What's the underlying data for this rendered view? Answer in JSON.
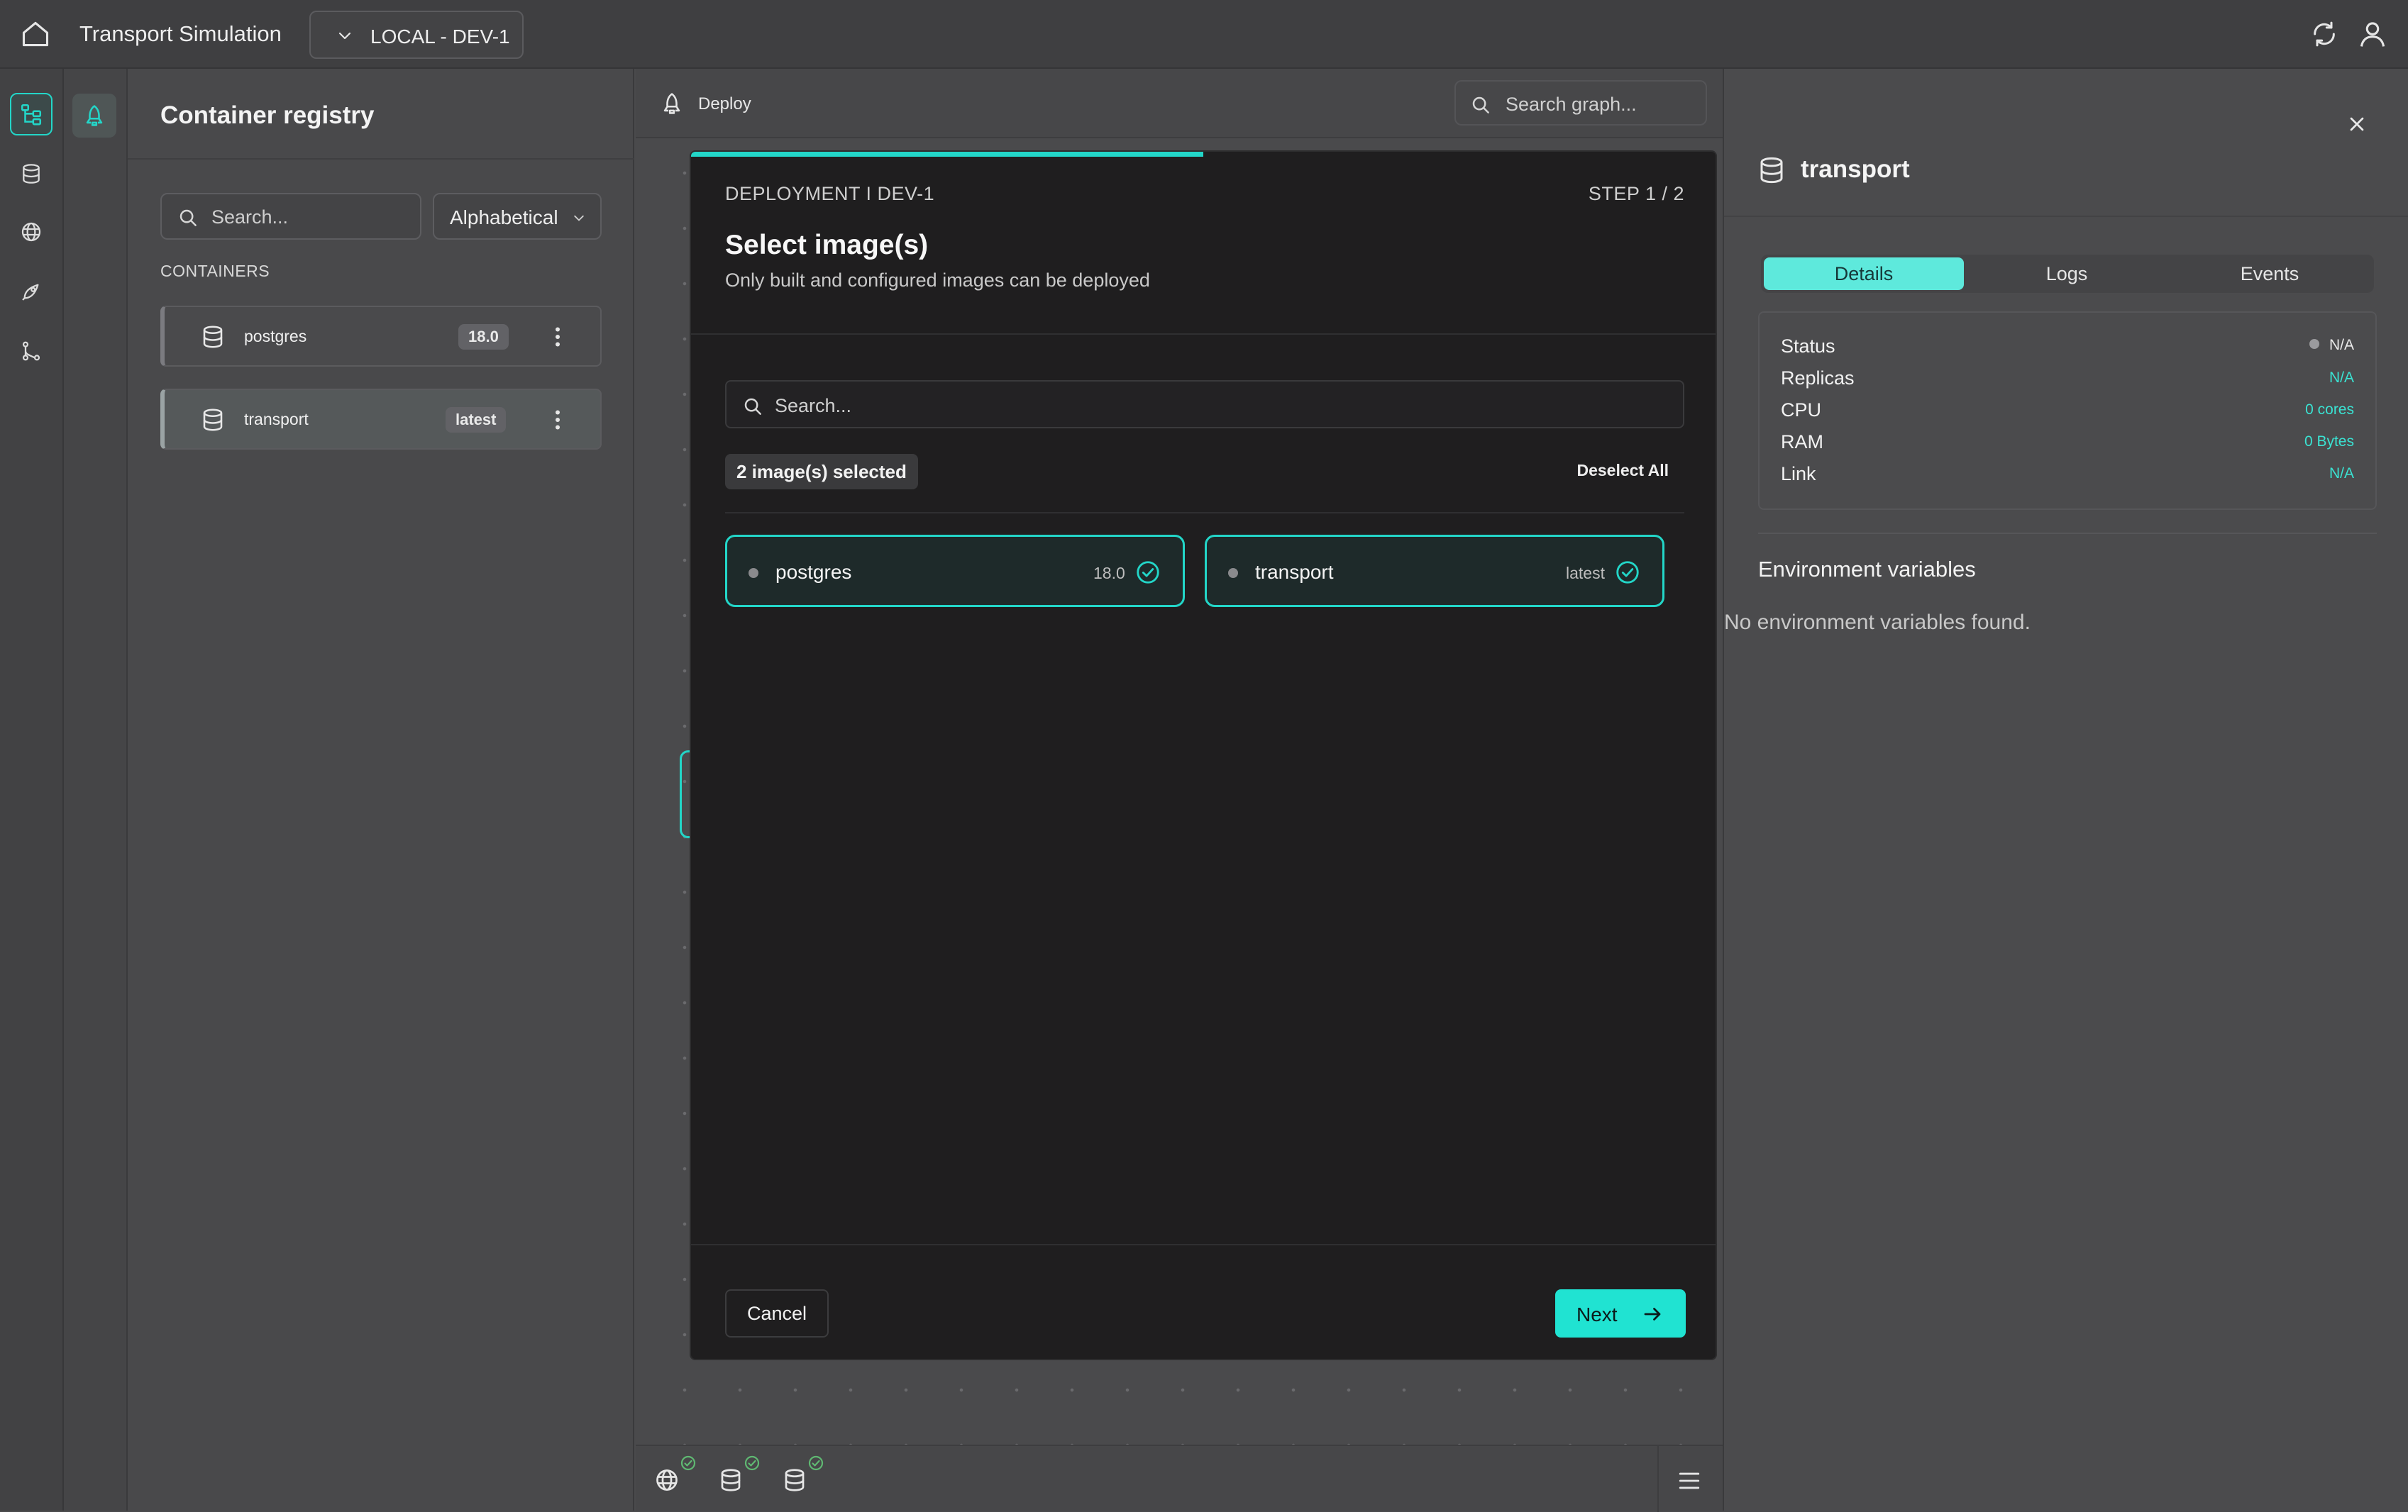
{
  "app": {
    "title": "Transport Simulation",
    "environment": "LOCAL - DEV-1"
  },
  "rail": {
    "items": [
      "tree-icon",
      "database-icon",
      "globe-icon",
      "rocket-icon",
      "branch-icon"
    ],
    "active": "tree-icon"
  },
  "registry": {
    "title": "Container registry",
    "search_placeholder": "Search...",
    "sort_label": "Alphabetical",
    "section_label": "CONTAINERS",
    "containers": [
      {
        "name": "postgres",
        "tag": "18.0",
        "selected": false
      },
      {
        "name": "transport",
        "tag": "latest",
        "selected": true
      }
    ]
  },
  "canvas": {
    "toolbar_label": "Deploy",
    "search_placeholder": "Search graph...",
    "bottom_icons": [
      "globe-icon",
      "database-icon",
      "database-icon"
    ]
  },
  "modal": {
    "eyebrow": "DEPLOYMENT I DEV-1",
    "step": "STEP 1 / 2",
    "progress": 0.5,
    "title": "Select image(s)",
    "subtitle": "Only built and configured images can be deployed",
    "search_placeholder": "Search...",
    "selected_count": "2 image(s) selected",
    "deselect_all": "Deselect All",
    "images": [
      {
        "name": "postgres",
        "tag": "18.0",
        "selected": true
      },
      {
        "name": "transport",
        "tag": "latest",
        "selected": true
      }
    ],
    "cancel_label": "Cancel",
    "next_label": "Next"
  },
  "details_panel": {
    "name": "transport",
    "tabs": [
      "Details",
      "Logs",
      "Events"
    ],
    "active_tab": "Details",
    "rows": [
      {
        "label": "Status",
        "value": "N/A"
      },
      {
        "label": "Replicas",
        "value": "N/A"
      },
      {
        "label": "CPU",
        "value": "0 cores"
      },
      {
        "label": "RAM",
        "value": "0 Bytes"
      },
      {
        "label": "Link",
        "value": "N/A"
      }
    ],
    "env_title": "Environment variables",
    "env_empty": "No environment variables found."
  },
  "colors": {
    "accent": "#23d6c8",
    "button": "#20e3d2",
    "modal_bg": "#1f1e1f",
    "panel_bg": "#4a4a4c"
  }
}
